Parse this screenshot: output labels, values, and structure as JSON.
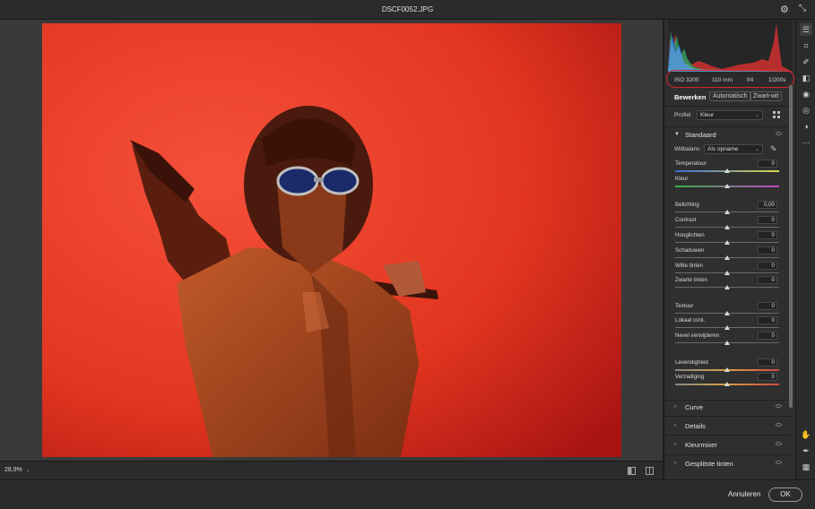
{
  "window": {
    "title": "DSCF0052.JPG"
  },
  "icons": {
    "settings": "gear-icon",
    "collapse": "collapse-arrows-icon"
  },
  "zoom": {
    "value": "28,9%"
  },
  "footer": {
    "cancel": "Annuleren",
    "ok": "OK"
  },
  "exif": {
    "iso": "ISO 3200",
    "focal": "110 mm",
    "aperture": "f/4",
    "shutter": "1/200s"
  },
  "tabs": {
    "edit": "Bewerken",
    "auto": "Automatisch",
    "bw": "Zwart-wit"
  },
  "profile": {
    "label": "Profiel",
    "value": "Kleur"
  },
  "basic": {
    "title": "Standaard",
    "wb_label": "Witbalans",
    "wb_value": "Als opname"
  },
  "sliders": [
    {
      "label": "Temperatuur",
      "value": "0",
      "position": 0.5
    },
    {
      "label": "Kleur",
      "value": "",
      "position": 0.5
    },
    {
      "label": "Belichting",
      "value": "0,00",
      "position": 0.5
    },
    {
      "label": "Contrast",
      "value": "0",
      "position": 0.5
    },
    {
      "label": "Hooglichten",
      "value": "0",
      "position": 0.5
    },
    {
      "label": "Schaduwen",
      "value": "0",
      "position": 0.5
    },
    {
      "label": "Witte tinten",
      "value": "0",
      "position": 0.5
    },
    {
      "label": "Zwarte tinten",
      "value": "0",
      "position": 0.5
    },
    {
      "label": "Textuur",
      "value": "0",
      "position": 0.5
    },
    {
      "label": "Lokaal cont.",
      "value": "0",
      "position": 0.5
    },
    {
      "label": "Nevel verwijderen",
      "value": "0",
      "position": 0.5
    },
    {
      "label": "Levendigheid",
      "value": "0",
      "position": 0.5
    },
    {
      "label": "Verzadiging",
      "value": "0",
      "position": 0.5
    }
  ],
  "sections": {
    "curve": "Curve",
    "details": "Details",
    "mixer": "Kleurmixer",
    "split": "Gesplitste tinten"
  },
  "colors": {
    "accent_red": "#d2262b",
    "photo_background": "#e8402a",
    "panel": "#2f2f2f"
  }
}
